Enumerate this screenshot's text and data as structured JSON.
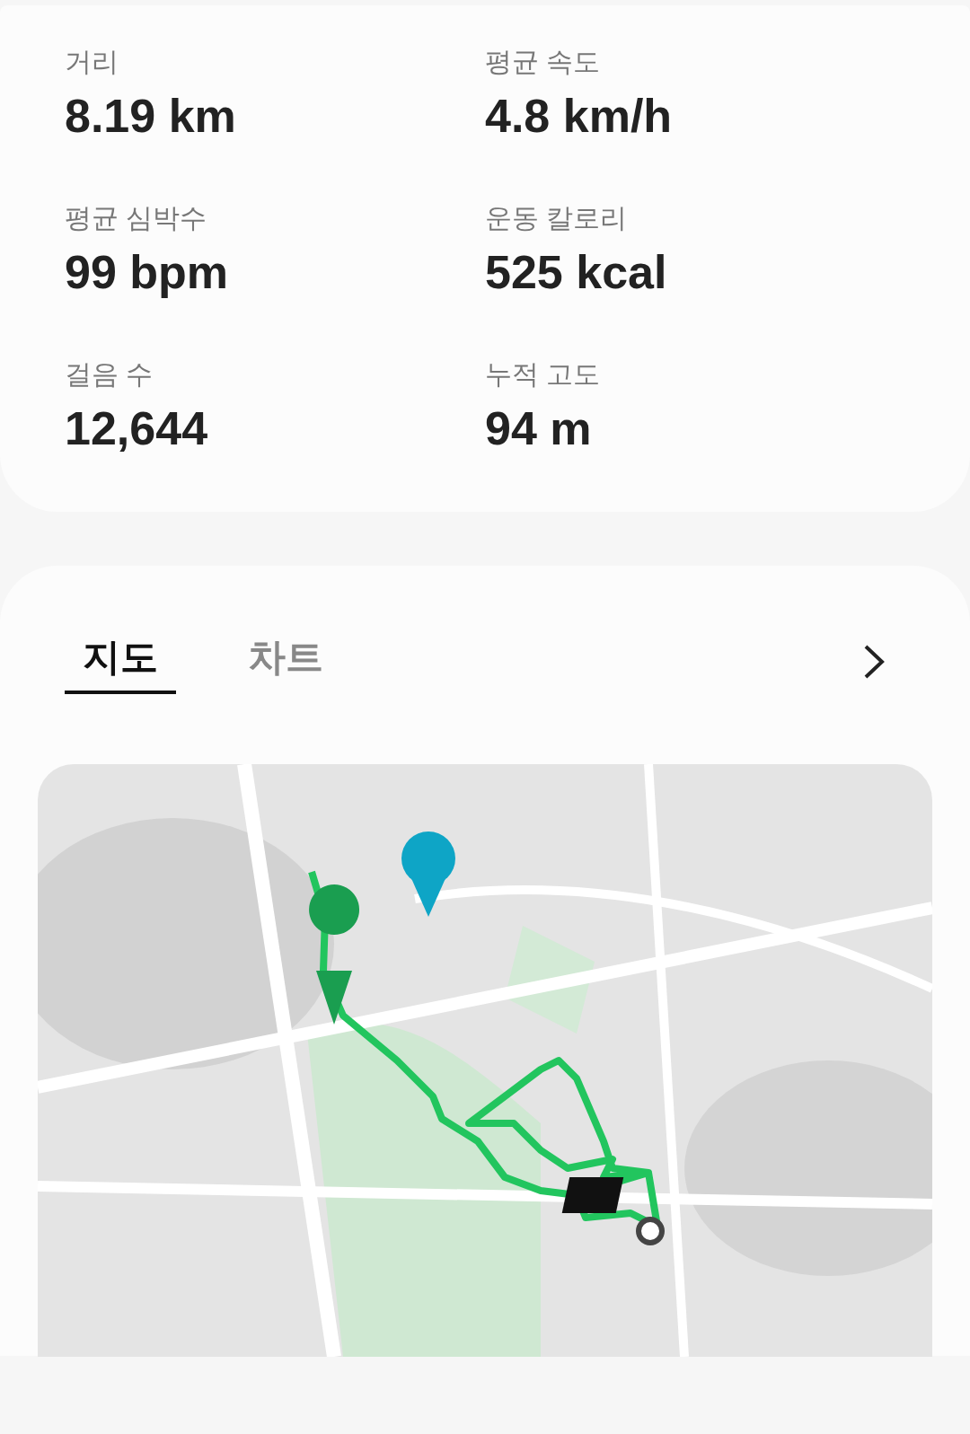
{
  "stats": [
    {
      "label": "거리",
      "value": "8.19 km"
    },
    {
      "label": "평균 속도",
      "value": "4.8 km/h"
    },
    {
      "label": "평균 심박수",
      "value": "99 bpm"
    },
    {
      "label": "운동 칼로리",
      "value": "525 kcal"
    },
    {
      "label": "걸음 수",
      "value": "12,644"
    },
    {
      "label": "누적 고도",
      "value": "94 m"
    }
  ],
  "tabs": [
    {
      "label": "지도",
      "selected": true
    },
    {
      "label": "차트",
      "selected": false
    }
  ]
}
